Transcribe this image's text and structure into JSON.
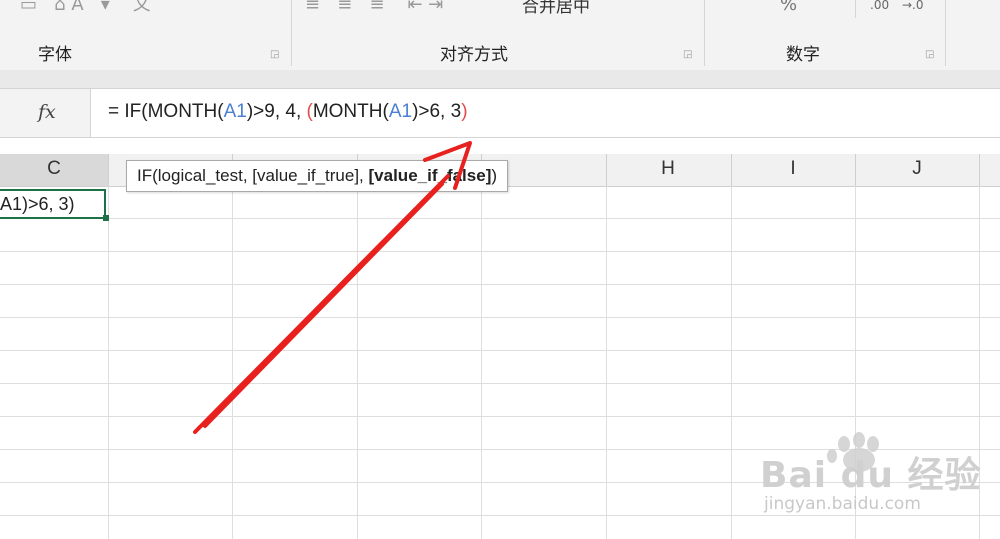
{
  "ribbon": {
    "groups": [
      {
        "label": "字体"
      },
      {
        "label": "对齐方式"
      },
      {
        "label": "数字"
      }
    ],
    "top_fragments": {
      "merge_center": "合并居中",
      "percent": "%",
      "decimal_add": ".00",
      "decimal_remove": "→.0"
    }
  },
  "formula_bar": {
    "fx_label": "fx",
    "formula_parts": [
      {
        "text": "= IF(MONTH(",
        "kind": "plain"
      },
      {
        "text": "A1",
        "kind": "ref"
      },
      {
        "text": ")>9, 4, ",
        "kind": "plain"
      },
      {
        "text": "(",
        "kind": "paren"
      },
      {
        "text": "MONTH(",
        "kind": "plain"
      },
      {
        "text": "A1",
        "kind": "ref"
      },
      {
        "text": ")>6, 3",
        "kind": "plain"
      },
      {
        "text": ")",
        "kind": "paren"
      }
    ]
  },
  "columns": [
    "C",
    "H",
    "I",
    "J"
  ],
  "tooltip": {
    "prefix": "IF(logical_test, [value_if_true], ",
    "bold": "[value_if_false]",
    "suffix": ")"
  },
  "active_cell": {
    "text": "A1)>6, 3)"
  },
  "colors": {
    "ref": "#4a7fd4",
    "paren": "#e24b4b",
    "active_border": "#1e7145",
    "arrow": "#e8201e"
  },
  "watermark": {
    "brand": "Bai du 经验",
    "url": "jingyan.baidu.com"
  }
}
